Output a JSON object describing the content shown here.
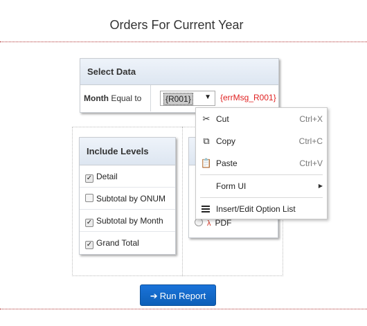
{
  "page": {
    "title": "Orders For Current Year"
  },
  "select_data": {
    "header": "Select Data",
    "field_label_bold": "Month",
    "field_label_rest": " Equal to",
    "select_value": "{R001}",
    "error_msg": "{errMsg_R001}"
  },
  "include_levels": {
    "header": "Include Levels",
    "items": [
      {
        "label": "Detail",
        "checked": true
      },
      {
        "label": "Subtotal by ONUM",
        "checked": false
      },
      {
        "label": "Subtotal by Month",
        "checked": true
      },
      {
        "label": "Grand Total",
        "checked": true
      }
    ]
  },
  "output": {
    "pdf_label": "PDF"
  },
  "run_button": {
    "label": "Run Report"
  },
  "context_menu": {
    "cut": {
      "label": "Cut",
      "shortcut": "Ctrl+X",
      "icon": "scissors-icon"
    },
    "copy": {
      "label": "Copy",
      "shortcut": "Ctrl+C",
      "icon": "copy-icon"
    },
    "paste": {
      "label": "Paste",
      "shortcut": "Ctrl+V",
      "icon": "clipboard-icon"
    },
    "form_ui": {
      "label": "Form UI"
    },
    "option_list": {
      "label": "Insert/Edit Option List",
      "icon": "list-icon"
    }
  },
  "colors": {
    "accent": "#1a73d9",
    "error": "#e02020",
    "rule": "#b03030"
  }
}
